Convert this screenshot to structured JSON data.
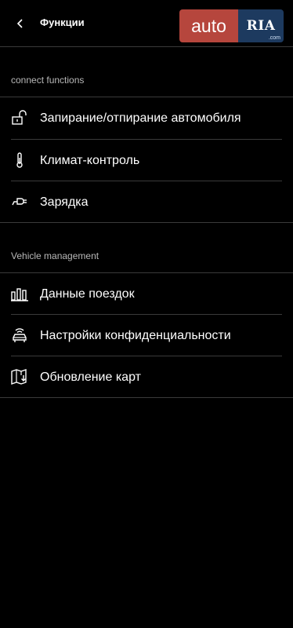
{
  "header": {
    "title": "Функции",
    "back_icon": "chevron-left-icon"
  },
  "watermark": {
    "part1": "auto",
    "part2": "RIA",
    "part3": ".com",
    "colors": {
      "auto_bg": "#b6463d",
      "ria_bg": "#1d3a5f"
    }
  },
  "sections": [
    {
      "header": "connect functions",
      "items": [
        {
          "label": "Запирание/отпирание автомобиля",
          "icon": "unlock-icon"
        },
        {
          "label": "Климат-контроль",
          "icon": "thermometer-icon"
        },
        {
          "label": "Зарядка",
          "icon": "charging-plug-icon"
        }
      ]
    },
    {
      "header": "Vehicle management",
      "items": [
        {
          "label": "Данные поездок",
          "icon": "trip-data-icon"
        },
        {
          "label": "Настройки конфиденциальности",
          "icon": "privacy-car-icon"
        },
        {
          "label": "Обновление карт",
          "icon": "map-update-icon"
        }
      ]
    }
  ],
  "theme": {
    "background": "#000000",
    "text": "#ffffff",
    "section_text": "#b8b8b8",
    "divider": "#3a3a3a"
  }
}
